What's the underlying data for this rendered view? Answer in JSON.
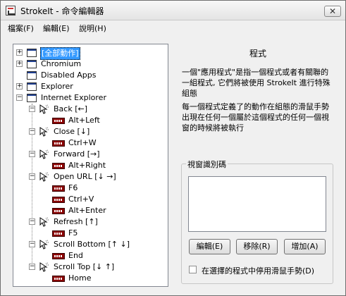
{
  "window": {
    "title": "StrokeIt - 命令編輯器",
    "close_glyph": "✕"
  },
  "menu": [
    "檔案(F)",
    "編輯(E)",
    "說明(H)"
  ],
  "tree": {
    "apps": [
      {
        "label": "[全部動作]",
        "expander": "+"
      },
      {
        "label": "Chromium",
        "expander": "+"
      },
      {
        "label": "Disabled Apps",
        "expander": ""
      },
      {
        "label": "Explorer",
        "expander": "+"
      },
      {
        "label": "Internet Explorer",
        "expander": "−"
      }
    ],
    "actions": [
      {
        "label": "Back [←]",
        "hotkey": "Alt+Left"
      },
      {
        "label": "Close [↓]",
        "hotkey": "Ctrl+W"
      },
      {
        "label": "Forward [→]",
        "hotkey": "Alt+Right"
      },
      {
        "label": "Open URL [↓ →]",
        "hotkeys": [
          "F6",
          "Ctrl+V",
          "Alt+Enter"
        ]
      },
      {
        "label": "Refresh [↑]",
        "hotkey": "F5"
      },
      {
        "label": "Scroll Bottom [↑ ↓]",
        "hotkey": "End"
      },
      {
        "label": "Scroll Top [↓ ↑]",
        "hotkey": "Home"
      }
    ]
  },
  "panel": {
    "title": "程式",
    "desc1": "一個\"應用程式\"是指一個程式或者有關聯的一組程式, 它們將被使用 StrokeIt 進行特殊組態",
    "desc2": "每一個程式定義了的動作在組態的滑鼠手勢出現在任何一個屬於這個程式的任何一個視窗的時候將被執行",
    "group_label": "視窗識別碼",
    "buttons": [
      "編輯(E)",
      "移除(R)",
      "增加(A)"
    ],
    "checkbox_label": "在選擇的程式中停用滑鼠手勢(D)"
  }
}
